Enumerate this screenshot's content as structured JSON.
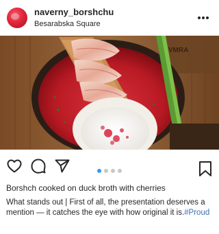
{
  "header": {
    "username": "naverny_borshchu",
    "location": "Besarabska Square",
    "more_icon": "more-horizontal-icon"
  },
  "photo": {
    "alt": "Bowl of red borshch with bacon on a board and sour cream",
    "sign_text": "VMRA"
  },
  "actions": {
    "like_icon": "heart-icon",
    "comment_icon": "comment-icon",
    "share_icon": "send-icon",
    "save_icon": "bookmark-icon",
    "carousel_total": 4,
    "carousel_active": 1
  },
  "caption": {
    "title": "Borshch cooked on duck broth with cherries",
    "text": "What stands out | First of all, the presentation deserves a mention — it catches the eye with how original it is.",
    "hashtag": "#Proud"
  },
  "colors": {
    "accent_blue": "#3897f0",
    "hashtag_blue": "#3a6fb0",
    "text": "#262626"
  }
}
